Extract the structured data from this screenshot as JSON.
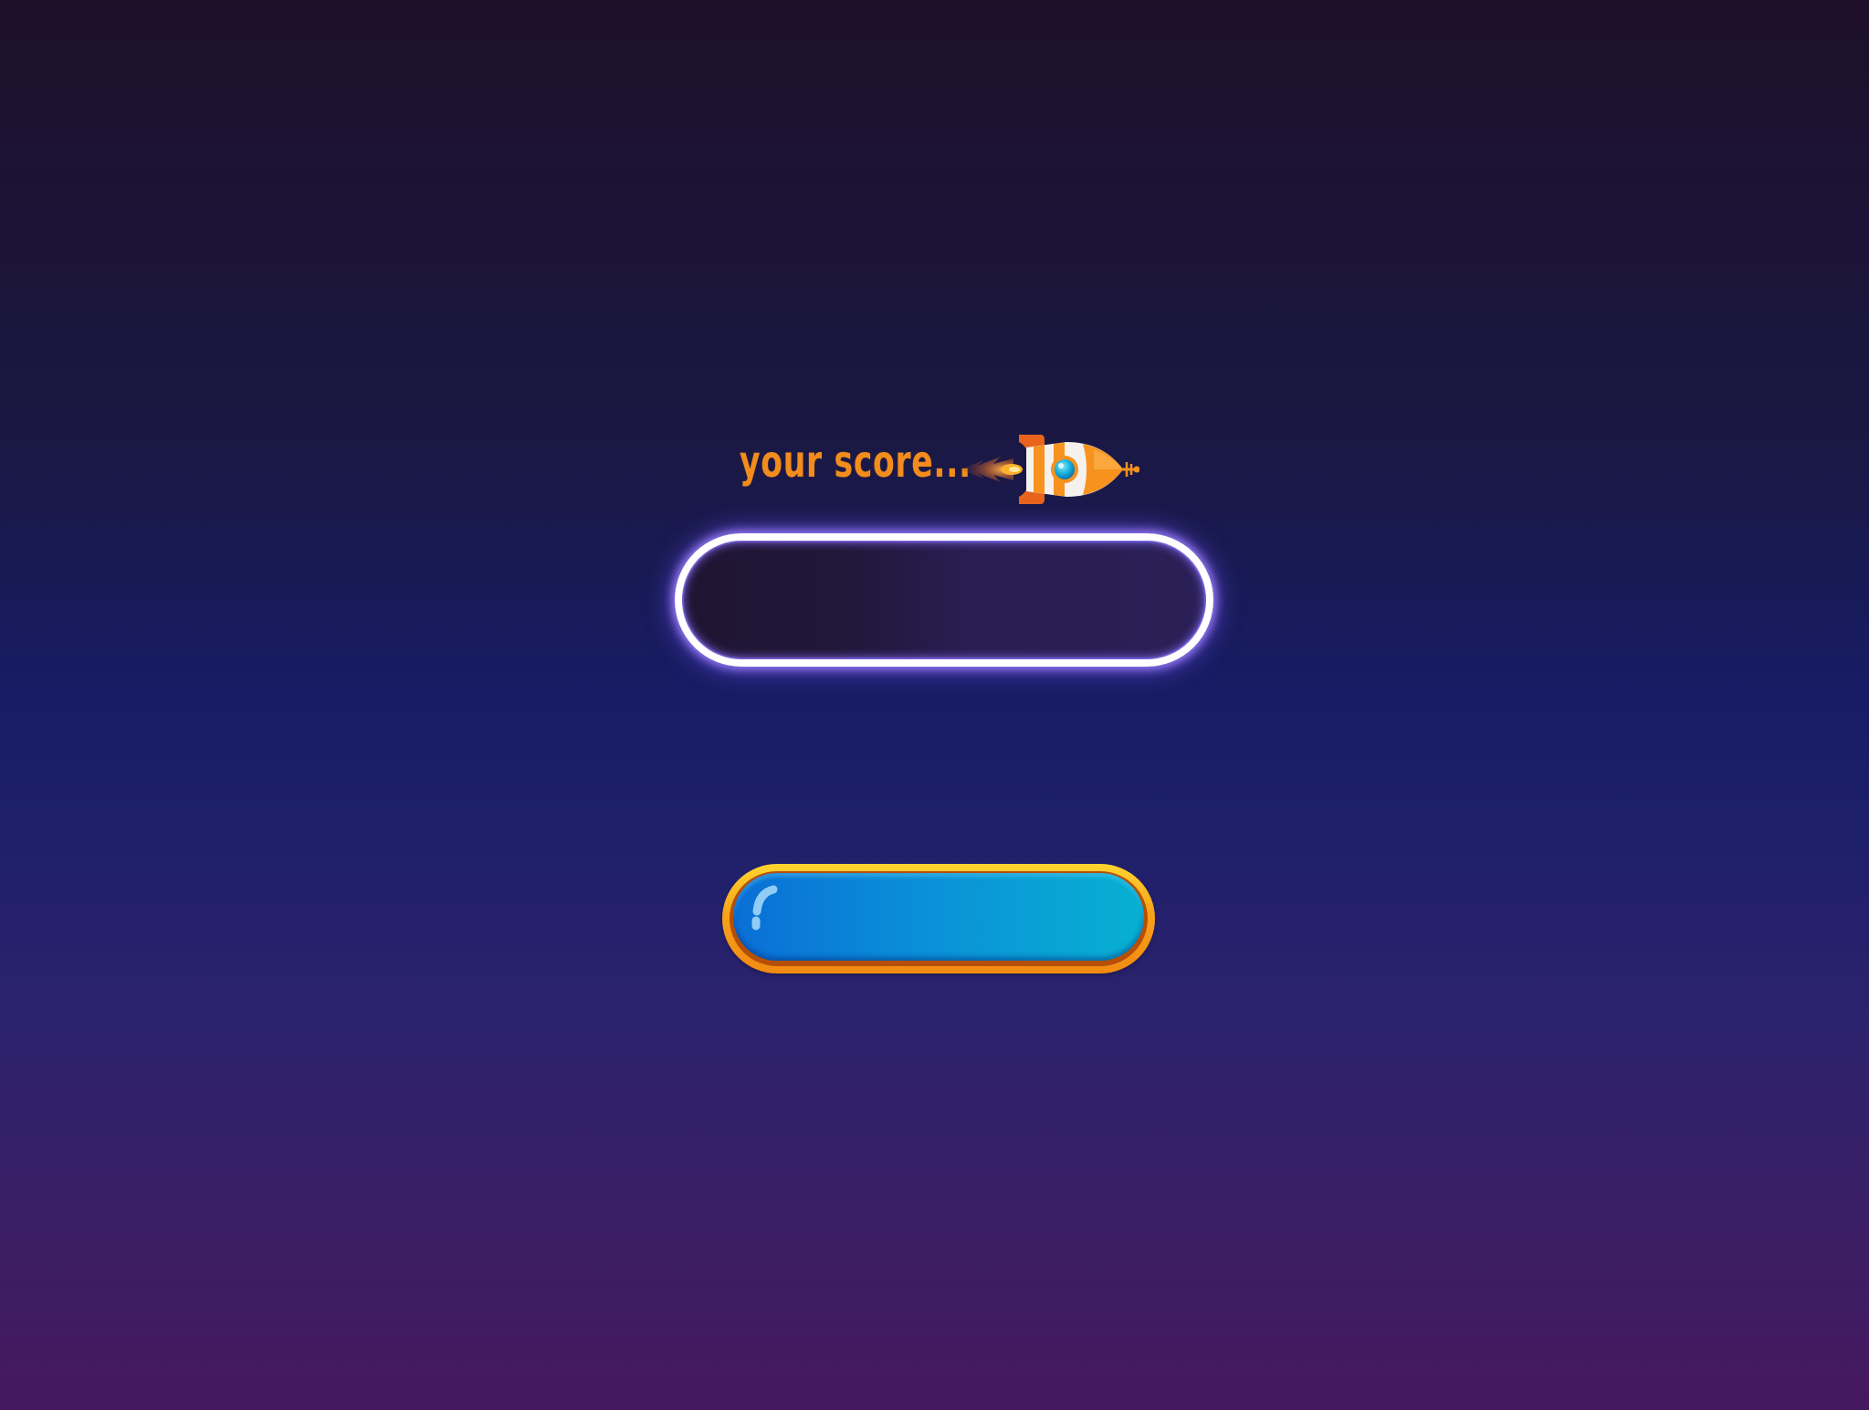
{
  "score": {
    "label": "your score...",
    "value": ""
  },
  "action_button": {
    "label": ""
  },
  "icons": {
    "rocket": "rocket-icon",
    "button_shine": "shine-highlight"
  },
  "colors": {
    "label_orange": "#f28c1c",
    "field_glow": "#8c6dff",
    "button_blue": "#0a8fd8",
    "button_gold": "#ffc21f"
  }
}
